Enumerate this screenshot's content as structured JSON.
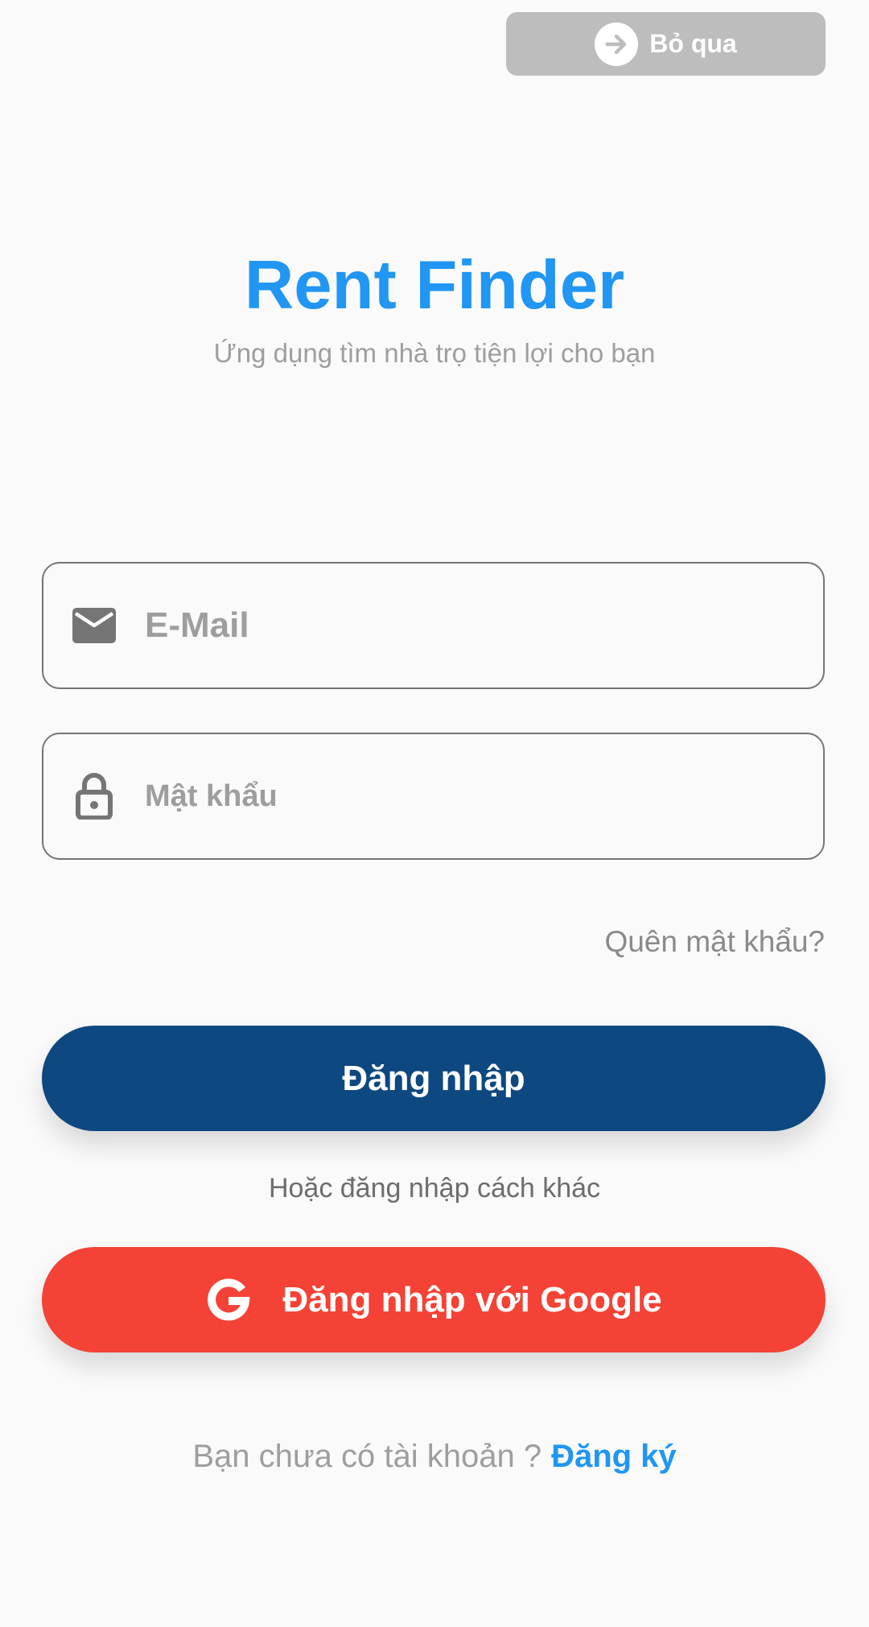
{
  "skip": {
    "label": "Bỏ qua",
    "icon": "arrow-right-circle-icon"
  },
  "header": {
    "title": "Rent Finder",
    "subtitle": "Ứng dụng tìm nhà trọ tiện lợi cho bạn"
  },
  "form": {
    "email": {
      "placeholder": "E-Mail",
      "value": "",
      "icon": "mail-icon"
    },
    "password": {
      "placeholder": "Mật khẩu",
      "value": "",
      "icon": "lock-icon"
    },
    "forgot_label": "Quên mật khẩu?",
    "login_label": "Đăng nhập"
  },
  "alt_login": {
    "text": "Hoặc đăng nhập cách khác",
    "google_label": "Đăng nhập với Google",
    "google_icon": "google-icon"
  },
  "signup": {
    "prompt": "Bạn chưa có tài khoản ?",
    "link_label": "Đăng ký"
  },
  "colors": {
    "brand_blue": "#2196f3",
    "primary_button": "#0d4880",
    "google_button": "#f44336",
    "skip_button": "#bdbdbd"
  }
}
